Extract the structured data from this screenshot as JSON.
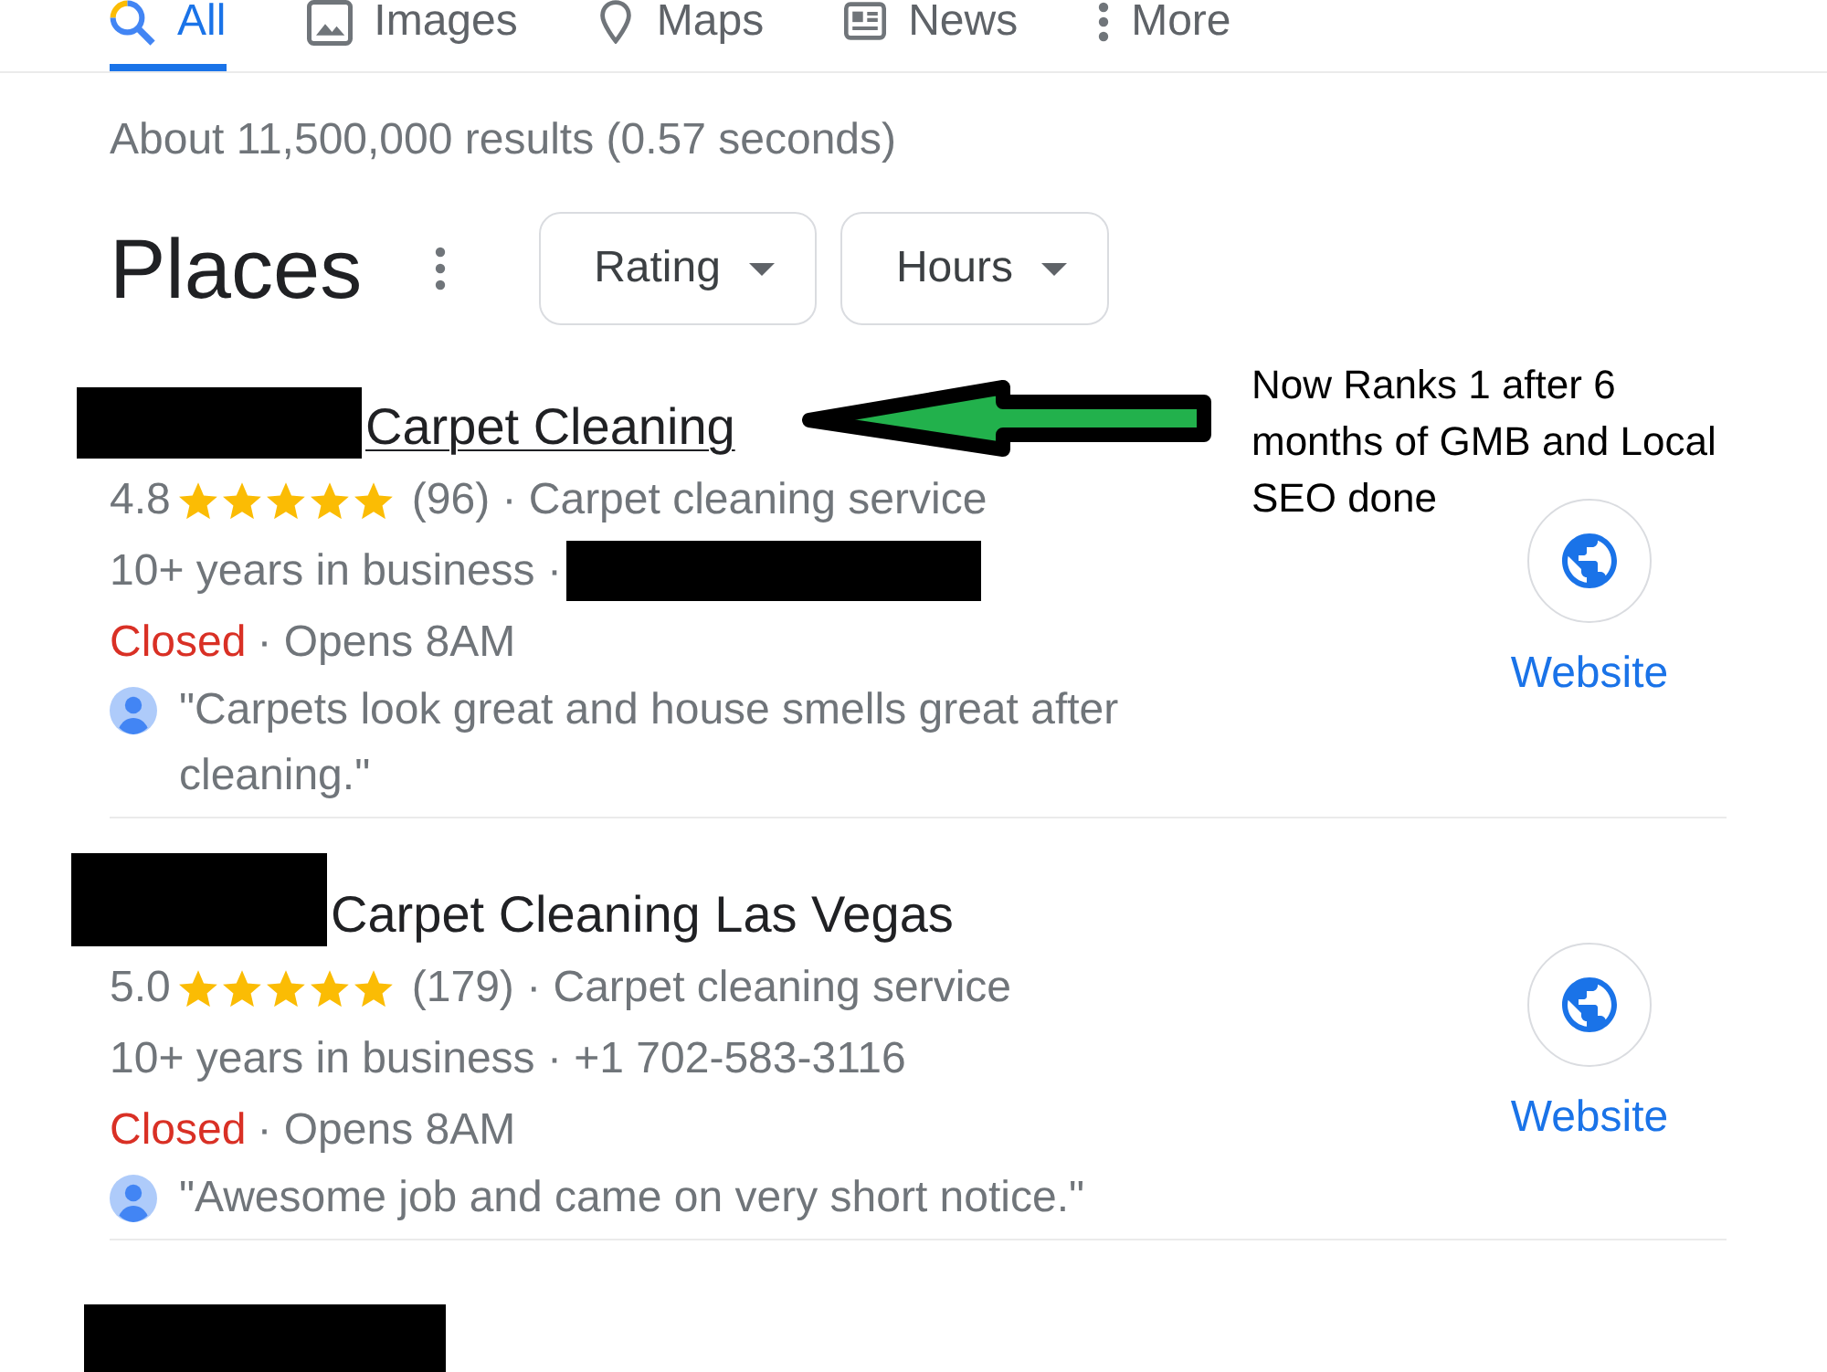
{
  "tabs": [
    {
      "label": "All",
      "selected": true
    },
    {
      "label": "Images",
      "selected": false
    },
    {
      "label": "Maps",
      "selected": false
    },
    {
      "label": "News",
      "selected": false
    },
    {
      "label": "More",
      "selected": false
    }
  ],
  "result_stats": "About 11,500,000 results (0.57 seconds)",
  "places": {
    "title": "Places",
    "filters": [
      {
        "label": "Rating"
      },
      {
        "label": "Hours"
      }
    ],
    "results": [
      {
        "title_redacted": true,
        "title": "Carpet Cleaning",
        "hovered": true,
        "rating": "4.8",
        "stars": 5,
        "rating_details": "(96) · Carpet cleaning service",
        "info": "10+ years in business ·",
        "info_redacted": true,
        "status": "Closed",
        "open": false,
        "hours": "· Opens 8AM",
        "review": "\"Carpets look great and house smells great after cleaning.\"",
        "website": "Website"
      },
      {
        "title_redacted": true,
        "title": "Carpet Cleaning Las Vegas",
        "hovered": false,
        "rating": "5.0",
        "stars": 5,
        "rating_details": "(179) · Carpet cleaning service",
        "info": "10+ years in business · +1 702-583-3116",
        "status": "Closed",
        "open": false,
        "hours": "· Opens 8AM",
        "review": "\"Awesome job and came on very short notice.\"",
        "website": "Website"
      },
      {
        "title_redacted": true
      }
    ]
  },
  "annotation": {
    "text": "Now Ranks 1 after 6 months of GMB and Local SEO done"
  }
}
